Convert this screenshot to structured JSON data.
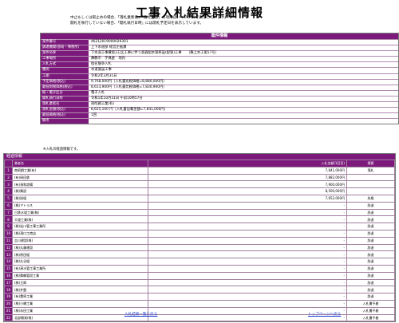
{
  "page": {
    "title": "工事入札結果詳細情報",
    "notes": [
      "中止もしくは取止めの場合、「落札業者名」「落札金額」の項目はハイフン(-)で表示しています。",
      "開札を執行していない場合、「開札執行日時」には開札予定日を表示しています。"
    ]
  },
  "info": {
    "header": "案件情報",
    "rows": [
      {
        "label": "案件番号",
        "value": "46212019000029301"
      },
      {
        "label": "調達機関(部局・事務所)",
        "value": "上下水道部 経営企画課"
      },
      {
        "label": "案件名称",
        "value": "下水道工事費第2工区工事に伴う高森配水管移設(配管)工事　　（舞上水工第57号）"
      },
      {
        "label": "工事場所",
        "value": "舞鶴市　字真倉　地内"
      },
      {
        "label": "入札方式",
        "value": "指名競争入札"
      },
      {
        "label": "種別",
        "value": "水道施設工事"
      },
      {
        "label": "工期",
        "value": "令和2年3月31日"
      },
      {
        "label": "予定価格(税込)",
        "value": "9,768,000円（入札書比較価格=8,880,000円）"
      },
      {
        "label": "最低制限価格(税込)",
        "value": "8,613,900円（入札書比較価格=7,830,900円）"
      },
      {
        "label": "紙・電子区分",
        "value": "電子入札"
      },
      {
        "label": "開札執行日時",
        "value": "令和1年10月31日 午前10時57分"
      },
      {
        "label": "落札業者名",
        "value": "南昭鋼工業(有)"
      },
      {
        "label": "落札金額(税込)",
        "value": "8,625,100 円（入札書記載金額=7,841,000円）"
      },
      {
        "label": "最低価格(税込)",
        "value": "1回"
      },
      {
        "label": "備考",
        "value": ""
      }
    ]
  },
  "note2": "※入札の経過情報です。",
  "keika": {
    "header": "経過情報",
    "columns": [
      "業者名",
      "入札金額(1回目)",
      "摘要"
    ],
    "rows": [
      {
        "no": "1",
        "name": "南昭鋼工業(有)",
        "amount": "7,841,000円",
        "result": "落札"
      },
      {
        "no": "2",
        "name": "(有)岡田鉄",
        "amount": "7,882,000円",
        "result": ""
      },
      {
        "no": "3",
        "name": "(有)須和設備",
        "amount": "7,900,000円",
        "result": ""
      },
      {
        "no": "4",
        "name": "(株)舞設",
        "amount": "8,500,000円",
        "result": ""
      },
      {
        "no": "5",
        "name": "(株)旭組",
        "amount": "7,652,000円",
        "result": "失格"
      },
      {
        "no": "6",
        "name": "(株)アトラス",
        "amount": "-",
        "result": "辞退"
      },
      {
        "no": "7",
        "name": "日鉄水道工業(株)",
        "amount": "-",
        "result": "辞退"
      },
      {
        "no": "8",
        "name": "大道工業(株)",
        "amount": "-",
        "result": "辞退"
      },
      {
        "no": "9",
        "name": "(株)岩川管工事工業所",
        "amount": "-",
        "result": "辞退"
      },
      {
        "no": "10",
        "name": "(株)滝口工商店",
        "amount": "-",
        "result": "辞退"
      },
      {
        "no": "11",
        "name": "吉川建設(株)",
        "amount": "-",
        "result": "辞退"
      },
      {
        "no": "12",
        "name": "(株)丸藤建設",
        "amount": "-",
        "result": "辞退"
      },
      {
        "no": "13",
        "name": "(株)原田組",
        "amount": "-",
        "result": "辞退"
      },
      {
        "no": "14",
        "name": "(株)丸谷組",
        "amount": "-",
        "result": "辞退"
      },
      {
        "no": "15",
        "name": "(有)湊水管工事工業所",
        "amount": "-",
        "result": "辞退"
      },
      {
        "no": "16",
        "name": "(株)舞鶴管設工業",
        "amount": "-",
        "result": "辞退"
      },
      {
        "no": "17",
        "name": "(株)玉興",
        "amount": "-",
        "result": "辞退"
      },
      {
        "no": "18",
        "name": "(株)井盤",
        "amount": "-",
        "result": "辞退"
      },
      {
        "no": "19",
        "name": "(有)豊原工業",
        "amount": "-",
        "result": "辞退"
      },
      {
        "no": "20",
        "name": "(株)小橋工業",
        "amount": "-",
        "result": "入札書不着"
      },
      {
        "no": "21",
        "name": "(株)永田工業",
        "amount": "-",
        "result": "入札書不着"
      },
      {
        "no": "22",
        "name": "北部開発(株)",
        "amount": "-",
        "result": "入札書不着"
      }
    ]
  },
  "links": {
    "list": "入札結果一覧に戻る",
    "top": "トップページへ戻る"
  },
  "colors": {
    "header_purple": "#7c1a7c",
    "link_blue": "#1a3bd1"
  }
}
